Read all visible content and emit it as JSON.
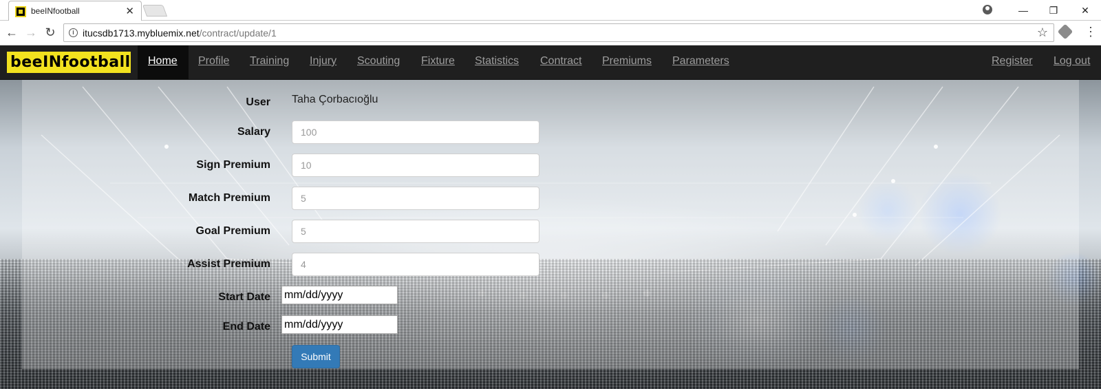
{
  "browser": {
    "tab_title": "beeINfootball",
    "url_host": "itucsdb1713.mybluemix.net",
    "url_path": "/contract/update/1"
  },
  "navbar": {
    "brand": "beeINfootball",
    "links": [
      "Home",
      "Profile",
      "Training",
      "Injury",
      "Scouting",
      "Fixture",
      "Statistics",
      "Contract",
      "Premiums",
      "Parameters"
    ],
    "right_links": [
      "Register",
      "Log out"
    ],
    "active": "Home"
  },
  "form": {
    "user_label": "User",
    "user_value": "Taha Çorbacıoğlu",
    "salary_label": "Salary",
    "salary_placeholder": "100",
    "sign_premium_label": "Sign Premium",
    "sign_premium_placeholder": "10",
    "match_premium_label": "Match Premium",
    "match_premium_placeholder": "5",
    "goal_premium_label": "Goal Premium",
    "goal_premium_placeholder": "5",
    "assist_premium_label": "Assist Premium",
    "assist_premium_placeholder": "4",
    "start_date_label": "Start Date",
    "end_date_label": "End Date",
    "date_placeholder": "mm/dd/yyyy",
    "submit_label": "Submit"
  },
  "colors": {
    "navbar_bg": "#1f1f1f",
    "brand_yellow": "#f2e21f",
    "submit_blue": "#337ab7"
  },
  "icons": [
    "favicon-icon",
    "close-icon",
    "back-arrow-icon",
    "forward-arrow-icon",
    "reload-icon",
    "info-icon",
    "star-icon",
    "extension-icon",
    "menu-icon",
    "profile-icon",
    "minimize-icon",
    "restore-icon",
    "window-close-icon"
  ]
}
